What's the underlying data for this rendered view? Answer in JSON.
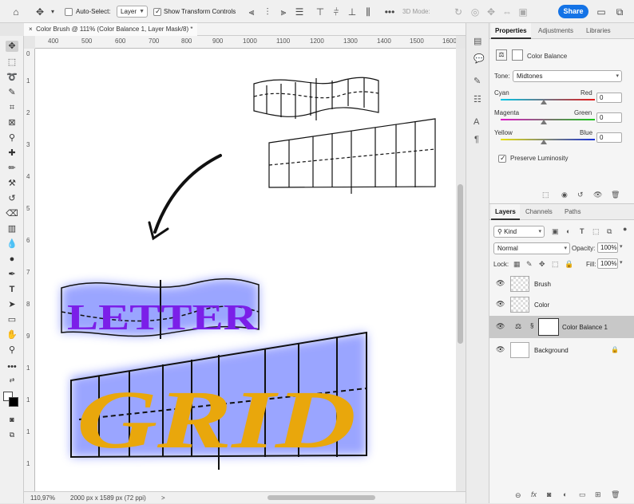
{
  "topbar": {
    "auto_select_label": "Auto-Select:",
    "auto_select_checked": false,
    "layer_select_value": "Layer",
    "show_transform_label": "Show Transform Controls",
    "show_transform_checked": true,
    "mode_3d_label": "3D Mode:",
    "share_label": "Share",
    "icons": [
      "home-icon",
      "move-icon",
      "align-left-icon",
      "align-center-icon",
      "align-right-icon",
      "distribute-icon",
      "align-top-icon",
      "align-middle-icon",
      "align-bottom-icon",
      "distribute-vertical-icon",
      "more-icon",
      "orbit-icon",
      "roll-icon",
      "pan-icon",
      "slide-icon",
      "scale-icon",
      "workspace-icon",
      "window-icon"
    ]
  },
  "document": {
    "tab_title": "Color Brush @ 111% (Color Balance 1, Layer Mask/8) *",
    "close_glyph": "×"
  },
  "rulers": {
    "h_ticks": [
      "400",
      "500",
      "600",
      "700",
      "800",
      "900",
      "1000",
      "1100",
      "1200",
      "1300",
      "1400",
      "1500",
      "1600"
    ],
    "v_ticks": [
      "0",
      "1",
      "2",
      "3",
      "4",
      "5",
      "6",
      "7",
      "8",
      "9",
      "1",
      "1",
      "1",
      "1"
    ]
  },
  "status": {
    "zoom": "110,97%",
    "doc_size": "2000 px x 1589 px (72 ppi)",
    "arrow": ">"
  },
  "artwork": {
    "word1": "LETTER",
    "word2": "GRID",
    "word1_color": "#7b1fe8",
    "word2_color": "#e9a70c",
    "glow_color": "#4a5cff"
  },
  "properties": {
    "tabs": [
      {
        "label": "Properties"
      },
      {
        "label": "Adjustments"
      },
      {
        "label": "Libraries"
      }
    ],
    "adjustment_name": "Color Balance",
    "tone_label": "Tone:",
    "tone_value": "Midtones",
    "sliders": [
      {
        "left": "Cyan",
        "right": "Red",
        "value": "0",
        "left_color": "#00c8e8",
        "right_color": "#e81818"
      },
      {
        "left": "Magenta",
        "right": "Green",
        "value": "0",
        "left_color": "#e018c8",
        "right_color": "#18c818"
      },
      {
        "left": "Yellow",
        "right": "Blue",
        "value": "0",
        "left_color": "#e8e010",
        "right_color": "#1830d8"
      }
    ],
    "preserve_label": "Preserve Luminosity",
    "preserve_checked": true
  },
  "layers": {
    "tabs": [
      {
        "label": "Layers"
      },
      {
        "label": "Channels"
      },
      {
        "label": "Paths"
      }
    ],
    "filter_value": "Kind",
    "blend_mode": "Normal",
    "opacity_label": "Opacity:",
    "opacity_value": "100%",
    "lock_label": "Lock:",
    "fill_label": "Fill:",
    "fill_value": "100%",
    "items": [
      {
        "name": "Brush",
        "type": "transparent",
        "selected": false
      },
      {
        "name": "Color",
        "type": "transparent",
        "selected": false
      },
      {
        "name": "Color Balance 1",
        "type": "adjustment",
        "selected": true
      },
      {
        "name": "Background",
        "type": "white",
        "selected": false
      }
    ]
  }
}
